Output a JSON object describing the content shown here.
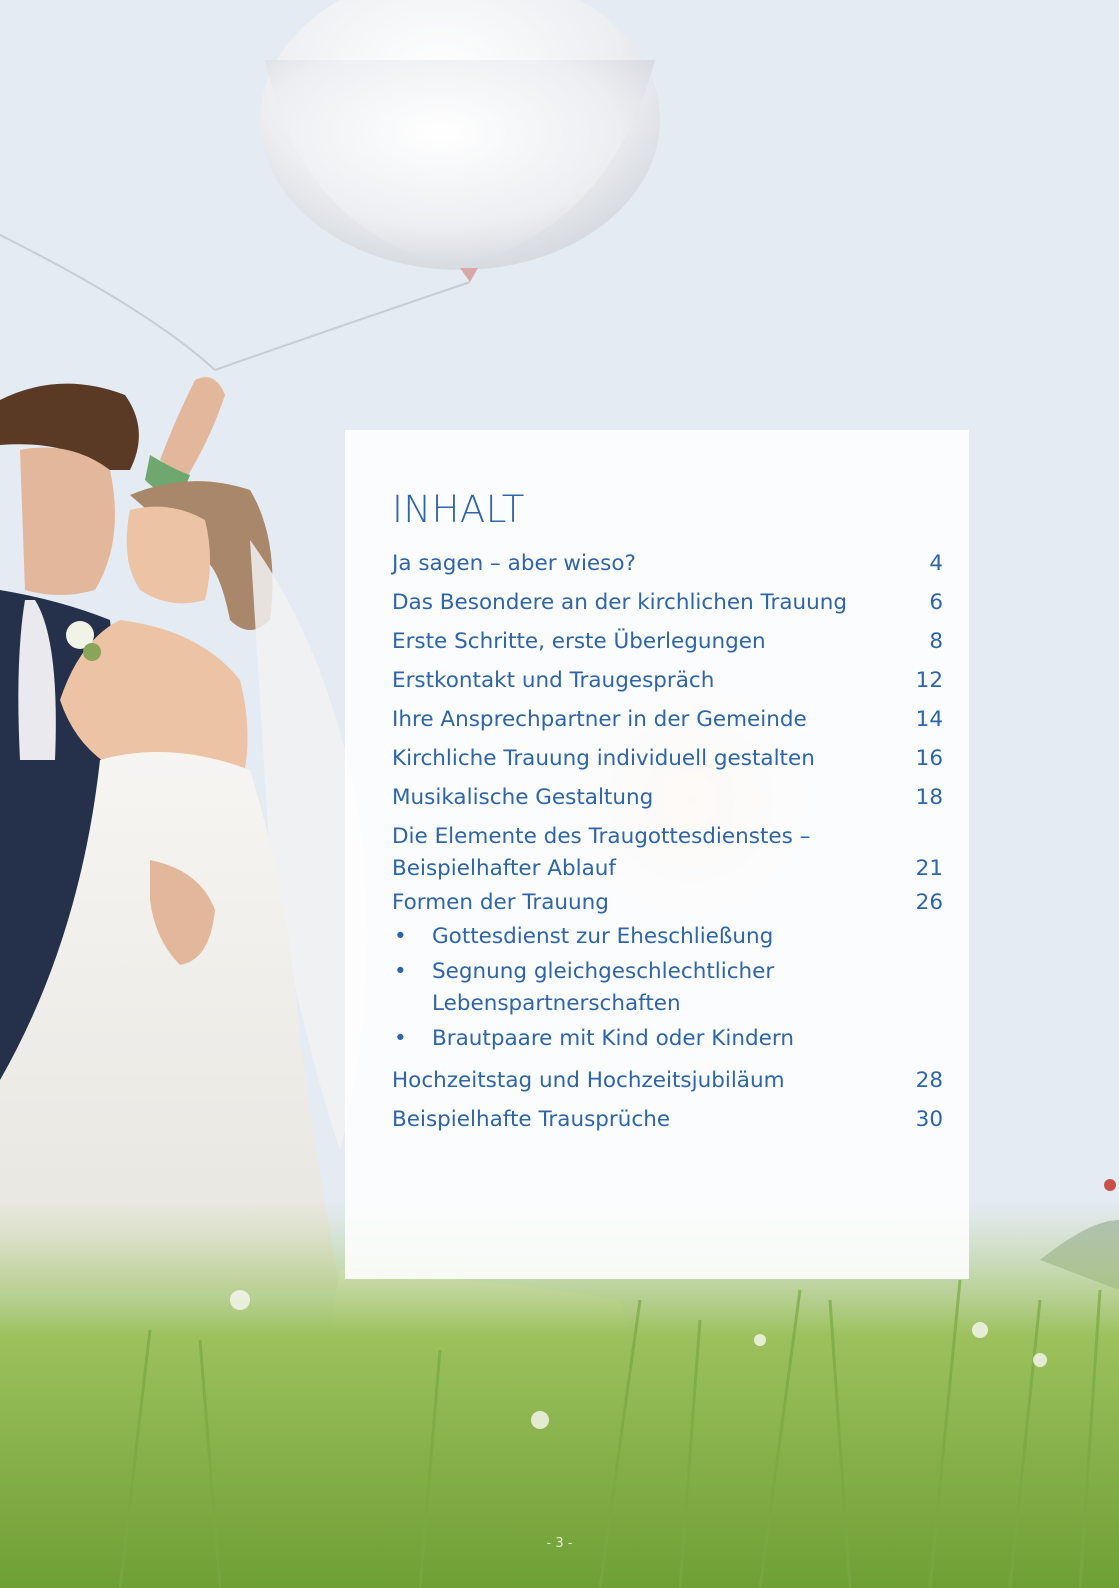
{
  "photo": {
    "description_icon": "wedding-photo-with-balloon"
  },
  "toc": {
    "title": "INHALT",
    "entries": [
      {
        "label": "Ja sagen – aber wieso?",
        "page": "4"
      },
      {
        "label": "Das Besondere an der kirchlichen Trauung",
        "page": "6"
      },
      {
        "label": "Erste Schritte, erste Überlegungen",
        "page": "8"
      },
      {
        "label": "Erstkontakt und Traugespräch",
        "page": "12"
      },
      {
        "label": "Ihre Ansprechpartner in der Gemeinde",
        "page": "14"
      },
      {
        "label": "Kirchliche Trauung individuell gestalten",
        "page": "16"
      },
      {
        "label": "Musikalische Gestaltung",
        "page": "18"
      },
      {
        "label": "Die Elemente des Traugottesdienstes –\nBeispielhafter Ablauf",
        "page": "21"
      },
      {
        "label": "Formen der Trauung",
        "page": "26"
      },
      {
        "label": "Hochzeitstag und Hochzeitsjubiläum",
        "page": "28"
      },
      {
        "label": "Beispielhafte Trausprüche",
        "page": "30"
      }
    ],
    "subitems": [
      {
        "bullet": "•",
        "text": "Gottesdienst zur Eheschließung"
      },
      {
        "bullet": "•",
        "text": "Segnung gleichgeschlechtlicher\nLebenspartnerschaften"
      },
      {
        "bullet": "•",
        "text": "Brautpaare mit Kind oder Kindern"
      }
    ]
  },
  "footer": {
    "page_number": "- 3 -"
  },
  "colors": {
    "text_blue": "#2e64a8",
    "card_bg": "#ffffff"
  }
}
